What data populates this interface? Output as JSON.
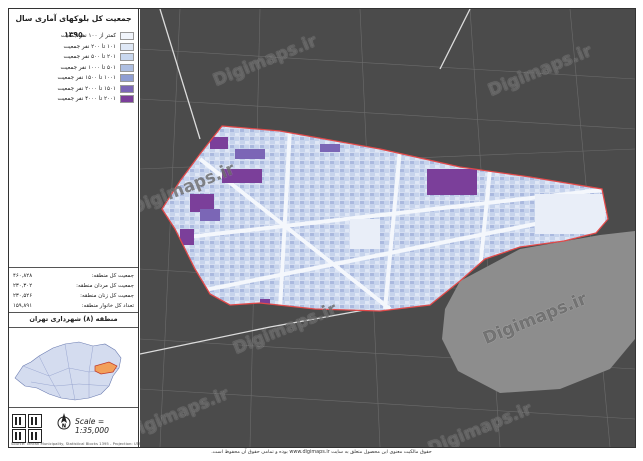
{
  "map_title": "جمعیت کل بلوکهای آماری سال ۱۳۹۵",
  "legend": [
    {
      "label": "کمتر از ۱۰۰ نفر جمعیت",
      "color": "#f1f5fc"
    },
    {
      "label": "۱۰۱ تا ۲۰۰ نفر جمعیت",
      "color": "#dfe8f6"
    },
    {
      "label": "۲۰۱ تا ۵۰۰ نفر جمعیت",
      "color": "#c9d8ef"
    },
    {
      "label": "۵۰۱ تا ۱۰۰۰ نفر جمعیت",
      "color": "#aebfe2"
    },
    {
      "label": "۱۰۰۱ تا ۱۵۰۰ نفر جمعیت",
      "color": "#8f9ed3"
    },
    {
      "label": "۱۵۰۱ تا ۲۰۰۰ نفر جمعیت",
      "color": "#7b66b6"
    },
    {
      "label": "۲۰۰۱ تا ۴۰۰۰ نفر جمعیت",
      "color": "#7b3f9a"
    }
  ],
  "stats": [
    {
      "label": "جمعیت کل منطقه:",
      "value": "۴۶۰,۸۲۸"
    },
    {
      "label": "جمعیت کل مردان منطقه:",
      "value": "۲۳۰,۳۰۲"
    },
    {
      "label": "جمعیت کل زنان منطقه:",
      "value": "۲۳۰,۵۲۶"
    },
    {
      "label": "تعداد کل خانوار منطقه:",
      "value": "۱۵۹,۸۹۱"
    }
  ],
  "region_title": "منطقه (۸) شهرداری تهران",
  "scale_text": "Scale = 1:35,000",
  "north_label": "N",
  "watermark": "Digimaps.ir",
  "footer": "حقوق مالکیت معنوی این محصول متعلق به سایت www.digimaps.ir بوده و تمامی حقوق آن محفوظ است.",
  "credit_small": "Source: Tehran Municipality, Statistical Blocks 1395 - Projection: UTM Zone 39N",
  "colors": {
    "boundary": "#e24a4a",
    "basemap": "#4a4a4a",
    "inset_highlight": "#f2a05a"
  }
}
